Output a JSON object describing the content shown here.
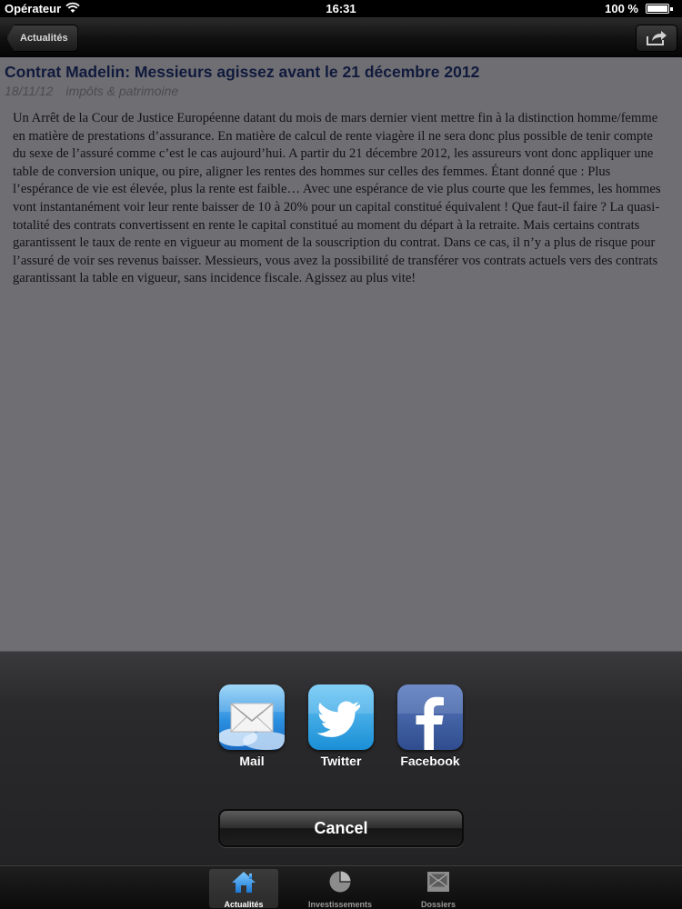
{
  "status_bar": {
    "carrier": "Opérateur",
    "time": "16:31",
    "battery": "100 %"
  },
  "navbar": {
    "back_label": "Actualités",
    "share_icon": "share-icon"
  },
  "article": {
    "title": "Contrat Madelin: Messieurs agissez avant le 21 décembre 2012",
    "date": "18/11/12",
    "category": "impôts & patrimoine",
    "body": "Un Arrêt de la Cour de Justice Européenne datant du mois de mars dernier vient mettre fin à la distinction homme/femme en matière de prestations d’assurance. En matière de calcul de rente viagère il ne sera donc plus possible de tenir compte du sexe de l’assuré comme c’est le cas aujourd’hui. A partir du 21 décembre 2012, les assureurs vont donc appliquer une table de conversion unique, ou pire, aligner les rentes des hommes sur celles des femmes. Étant donné que : Plus l’espérance de vie est élevée, plus la rente est faible… Avec une espérance de vie plus courte que les femmes, les hommes vont instantanément voir leur rente baisser de 10 à 20% pour un capital constitué équivalent ! Que faut-il faire ? La quasi-totalité des contrats convertissent en rente le capital constitué au moment du départ à la retraite. Mais certains contrats garantissent le taux de rente en vigueur au moment de la souscription du contrat. Dans ce cas, il n’y a plus de risque pour l’assuré de voir ses revenus baisser. Messieurs, vous avez la possibilité de transférer vos contrats actuels vers des contrats garantissant la table en vigueur, sans incidence fiscale. Agissez au plus vite!"
  },
  "share_sheet": {
    "options": [
      {
        "label": "Mail",
        "icon": "mail-icon"
      },
      {
        "label": "Twitter",
        "icon": "twitter-icon"
      },
      {
        "label": "Facebook",
        "icon": "facebook-icon"
      }
    ],
    "cancel_label": "Cancel"
  },
  "tabbar": {
    "tabs": [
      {
        "label": "Actualités",
        "icon": "home-icon",
        "active": true
      },
      {
        "label": "Investissements",
        "icon": "pie-chart-icon",
        "active": false
      },
      {
        "label": "Dossiers",
        "icon": "folder-icon",
        "active": false
      }
    ]
  },
  "colors": {
    "content_background": "#6f6e73",
    "title_color": "#101a3c",
    "twitter_blue": "#2aa3e0",
    "facebook_blue": "#3b5998"
  }
}
